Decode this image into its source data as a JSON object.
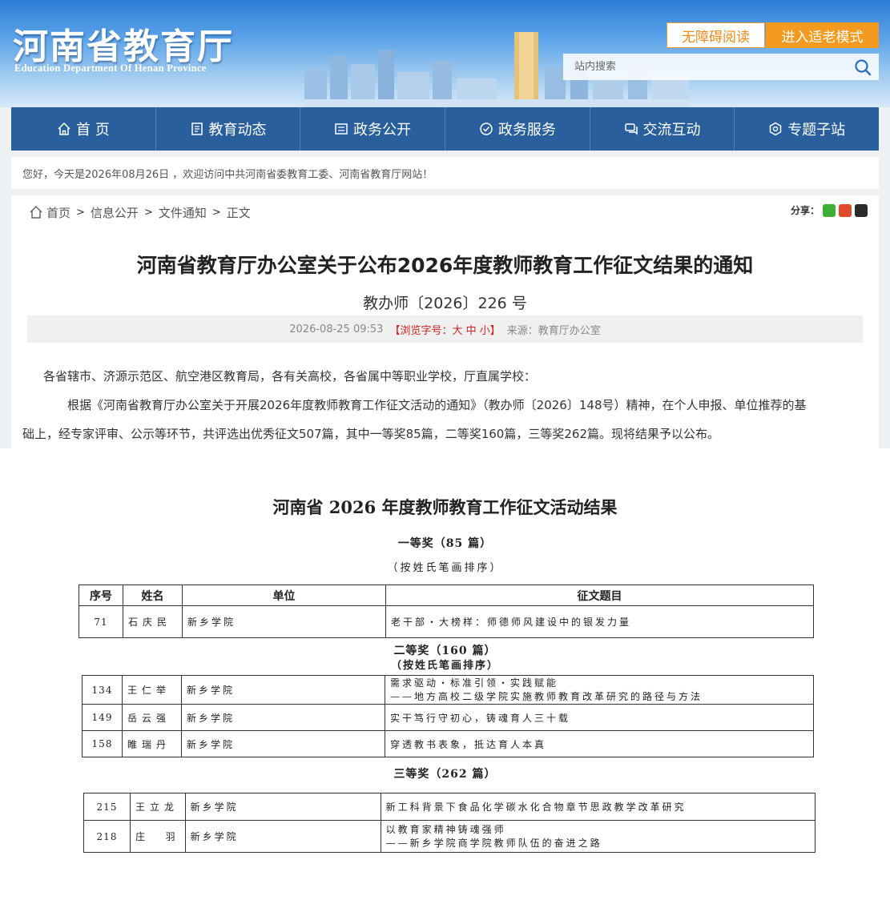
{
  "header": {
    "logo_title": "河南省教育厅",
    "logo_subtitle": "Education Department Of Henan Province",
    "accessible_reading": "无障碍阅读",
    "elder_mode": "进入适老模式",
    "search_placeholder": "站内搜索"
  },
  "nav": [
    {
      "label": "首 页",
      "icon": "home-icon"
    },
    {
      "label": "教育动态",
      "icon": "document-icon"
    },
    {
      "label": "政务公开",
      "icon": "notice-icon"
    },
    {
      "label": "政务服务",
      "icon": "service-icon"
    },
    {
      "label": "交流互动",
      "icon": "chat-icon"
    },
    {
      "label": "专题子站",
      "icon": "topic-icon"
    }
  ],
  "welcome": "您好，今天是2026年08月26日 ，欢迎访问中共河南省委教育工委、河南省教育厅网站！",
  "breadcrumb": {
    "items": [
      "首页",
      "信息公开",
      "文件通知",
      "正文"
    ],
    "sep": ">"
  },
  "share": {
    "label": "分享：",
    "icons": [
      "wechat-icon",
      "weibo-icon",
      "qq-icon"
    ],
    "colors": [
      "#3cb034",
      "#e04a2a",
      "#2a2a2a"
    ]
  },
  "article": {
    "title": "河南省教育厅办公室关于公布2026年度教师教育工作征文结果的通知",
    "doc_no": "教办师〔2026〕226 号",
    "date": "2026-08-25 09:53",
    "font_size_label": "【浏览字号：大 中 小】",
    "source": "来源：教育厅办公室",
    "recipients": "各省辖市、济源示范区、航空港区教育局，各有关高校，各省属中等职业学校，厅直属学校：",
    "paragraph_1": "根据《河南省教育厅办公室关于开展2026年度教师教育工作征文活动的通知》（教办师〔2026〕148号）精神，在个人申报、单位推荐的基",
    "paragraph_2": "础上，经专家评审、公示等环节，共评选出优秀征文507篇，其中一等奖85篇，二等奖160篇，三等奖262篇。现将结果予以公布。"
  },
  "results": {
    "title": "河南省 2026 年度教师教育工作征文活动结果",
    "headers": [
      "序号",
      "姓名",
      "单位",
      "征文题目"
    ],
    "first": {
      "label": "一等奖（85 篇）",
      "note": "（按姓氏笔画排序）",
      "rows": [
        {
          "no": "71",
          "name": "石庆民",
          "unit": "新乡学院",
          "title": [
            "老干部・大榜样：师德师风建设中的银发力量"
          ]
        }
      ]
    },
    "second": {
      "label": "二等奖（160 篇）",
      "note": "（按姓氏笔画排序）",
      "rows": [
        {
          "no": "134",
          "name": "王仁举",
          "unit": "新乡学院",
          "title": [
            "需求驱动・标准引领・实践赋能",
            "——地方高校二级学院实施教师教育改革研究的路径与方法"
          ]
        },
        {
          "no": "149",
          "name": "岳云强",
          "unit": "新乡学院",
          "title": [
            "实干笃行守初心，铸魂育人三十载"
          ]
        },
        {
          "no": "158",
          "name": "睢瑞丹",
          "unit": "新乡学院",
          "title": [
            "穿透教书表象，抵达育人本真"
          ]
        }
      ]
    },
    "third": {
      "label": "三等奖（262 篇）",
      "rows": [
        {
          "no": "215",
          "name": "王立龙",
          "unit": "新乡学院",
          "title": [
            "新工科背景下食品化学碳水化合物章节思政教学改革研究"
          ]
        },
        {
          "no": "218",
          "name": "庄  羽",
          "unit": "新乡学院",
          "title": [
            "以教育家精神铸魂强师",
            "——新乡学院商学院教师队伍的奋进之路"
          ]
        }
      ]
    }
  }
}
